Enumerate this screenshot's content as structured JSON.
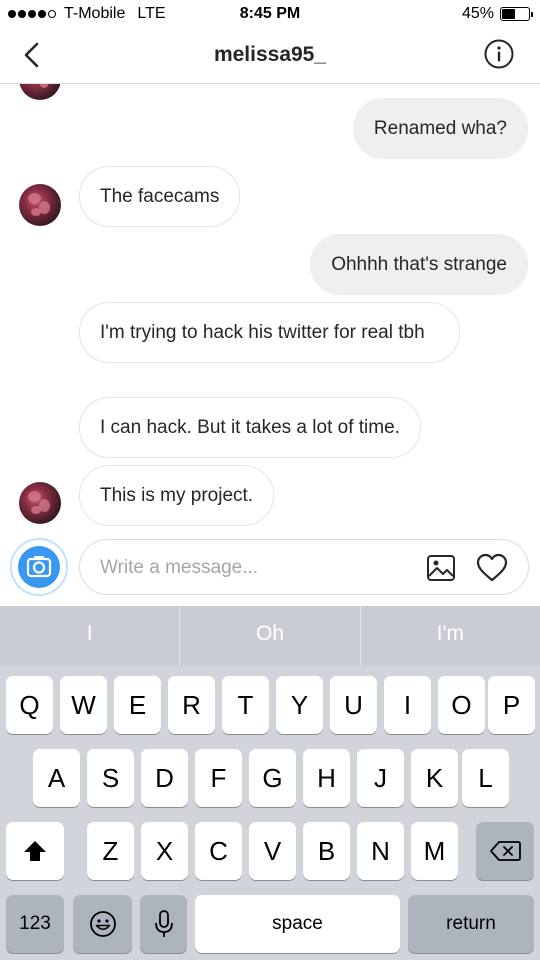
{
  "status_bar": {
    "carrier": "T-Mobile",
    "network": "LTE",
    "time": "8:45 PM",
    "battery_percent": "45%",
    "battery_level": 0.45
  },
  "header": {
    "title": "melissa95_",
    "back_icon": "chevron-left-icon",
    "info_icon": "info-icon"
  },
  "messages": [
    {
      "sender": "me",
      "text": "Renamed wha?"
    },
    {
      "sender": "them",
      "text": "The facecams"
    },
    {
      "sender": "me",
      "text": "Ohhhh that's strange"
    },
    {
      "sender": "them",
      "text": "I'm trying to hack his twitter for real tbh"
    },
    {
      "sender": "them",
      "text": "I can hack. But it takes a lot of time."
    },
    {
      "sender": "them",
      "text": "This is my project."
    }
  ],
  "composer": {
    "placeholder": "Write a message...",
    "camera_icon": "camera-icon",
    "gallery_icon": "gallery-icon",
    "heart_icon": "heart-icon",
    "accent_color": "#3897f0"
  },
  "keyboard": {
    "predictions": [
      "I",
      "Oh",
      "I'm"
    ],
    "row1": [
      "Q",
      "W",
      "E",
      "R",
      "T",
      "Y",
      "U",
      "I",
      "O",
      "P"
    ],
    "row2": [
      "A",
      "S",
      "D",
      "F",
      "G",
      "H",
      "J",
      "K",
      "L"
    ],
    "row3": [
      "Z",
      "X",
      "C",
      "V",
      "B",
      "N",
      "M"
    ],
    "numbers_label": "123",
    "space_label": "space",
    "return_label": "return",
    "shift_icon": "shift-icon",
    "delete_icon": "delete-icon",
    "emoji_icon": "emoji-icon",
    "mic_icon": "microphone-icon"
  }
}
